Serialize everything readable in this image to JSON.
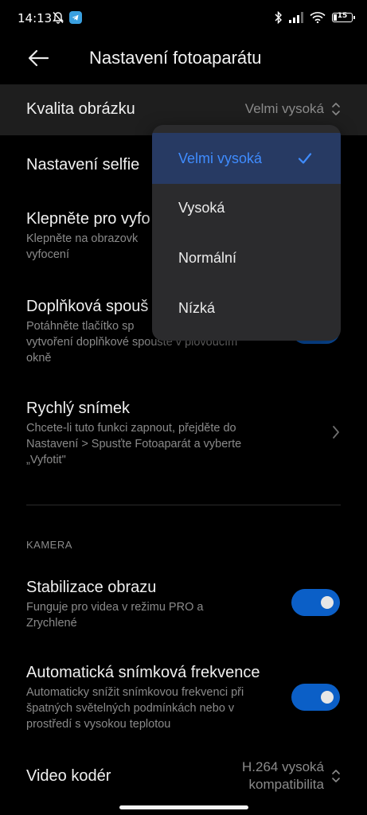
{
  "status_bar": {
    "time": "14:13",
    "battery_level": "15",
    "icons_left": [
      "mute-bell-icon",
      "telegram-icon"
    ],
    "icons_right": [
      "bluetooth-icon",
      "signal-icon",
      "wifi-icon",
      "battery-icon"
    ]
  },
  "header": {
    "title": "Nastavení fotoaparátu"
  },
  "settings": {
    "image_quality": {
      "title": "Kvalita obrázku",
      "value": "Velmi vysoká"
    },
    "selfie": {
      "title": "Nastavení selfie"
    },
    "tap_to_capture": {
      "title": "Klepněte pro vyfo",
      "subtitle_1": "Klepněte na obrazovk",
      "subtitle_2": "vyfocení"
    },
    "floating_shutter": {
      "title": "Doplňková spouš",
      "subtitle_1": "Potáhněte tlačítko sp",
      "subtitle_2": "vytvoření doplňkové spouště v plovoucím",
      "subtitle_3": "okně"
    },
    "quick_snap": {
      "title": "Rychlý snímek",
      "subtitle_1": "Chcete-li tuto funkci zapnout, přejděte do",
      "subtitle_2": "Nastavení > Spusťte Fotoaparát a vyberte",
      "subtitle_3": "„Vyfotit\""
    },
    "section_camera": "KAMERA",
    "stabilization": {
      "title": "Stabilizace obrazu",
      "subtitle_1": "Funguje pro videa v režimu PRO a",
      "subtitle_2": "Zrychlené",
      "enabled": true
    },
    "auto_fps": {
      "title": "Automatická snímková frekvence",
      "subtitle_1": "Automaticky snížit snímkovou frekvenci při",
      "subtitle_2": "špatných světelných podmínkách nebo v",
      "subtitle_3": "prostředí s vysokou teplotou",
      "enabled": true
    },
    "video_encoder": {
      "title": "Video kodér",
      "value_1": "H.264 vysoká",
      "value_2": "kompatibilita"
    }
  },
  "dropdown": {
    "options": [
      "Velmi vysoká",
      "Vysoká",
      "Normální",
      "Nízká"
    ],
    "selected": "Velmi vysoká"
  },
  "colors": {
    "accent": "#3f8cff",
    "toggle_on": "#0b5fc7",
    "background": "#000000",
    "dropdown_bg": "#2b2b2d"
  }
}
